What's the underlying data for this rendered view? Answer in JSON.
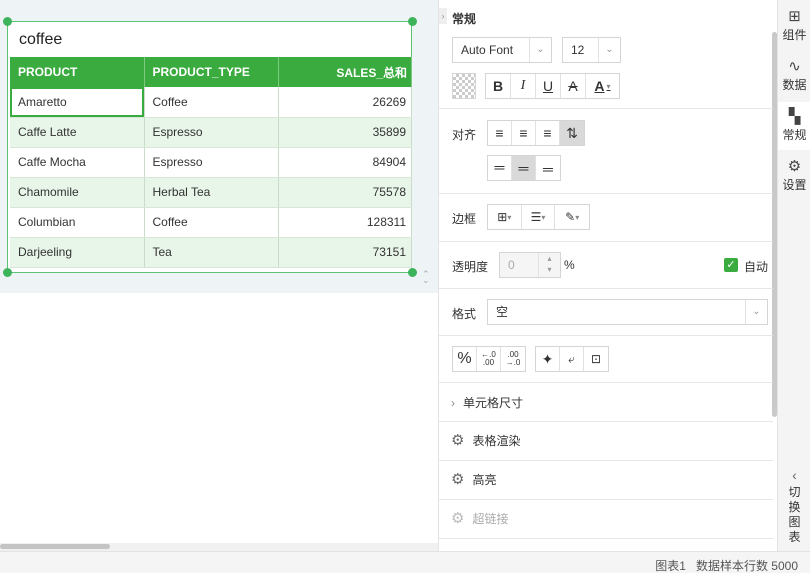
{
  "widget": {
    "title": "coffee",
    "columns": [
      "PRODUCT",
      "PRODUCT_TYPE",
      "SALES_总和"
    ],
    "rows": [
      [
        "Amaretto",
        "Coffee",
        "26269"
      ],
      [
        "Caffe Latte",
        "Espresso",
        "35899"
      ],
      [
        "Caffe Mocha",
        "Espresso",
        "84904"
      ],
      [
        "Chamomile",
        "Herbal Tea",
        "75578"
      ],
      [
        "Columbian",
        "Coffee",
        "128311"
      ],
      [
        "Darjeeling",
        "Tea",
        "73151"
      ]
    ]
  },
  "panel": {
    "header": "常规",
    "font_family": "Auto Font",
    "font_size": "12",
    "bold": "B",
    "italic": "I",
    "underline": "U",
    "strike": "A",
    "font_color": "A",
    "align_label": "对齐",
    "border_label": "边框",
    "opacity_label": "透明度",
    "opacity_value": "0",
    "opacity_unit": "%",
    "auto_label": "自动",
    "format_label": "格式",
    "format_value": "空",
    "percent": "%",
    "cell_size": "单元格尺寸",
    "table_render": "表格渲染",
    "highlight": "高亮",
    "hyperlink": "超链接"
  },
  "tabs": {
    "component": "组件",
    "data": "数据",
    "general": "常规",
    "settings": "设置",
    "switch_chart": [
      "切",
      "换",
      "图",
      "表"
    ]
  },
  "footer": {
    "chart_name": "图表1",
    "sample_rows": "数据样本行数 5000"
  },
  "colors": {
    "accent": "#3aab3e",
    "row_alt": "#e8f5e9"
  }
}
